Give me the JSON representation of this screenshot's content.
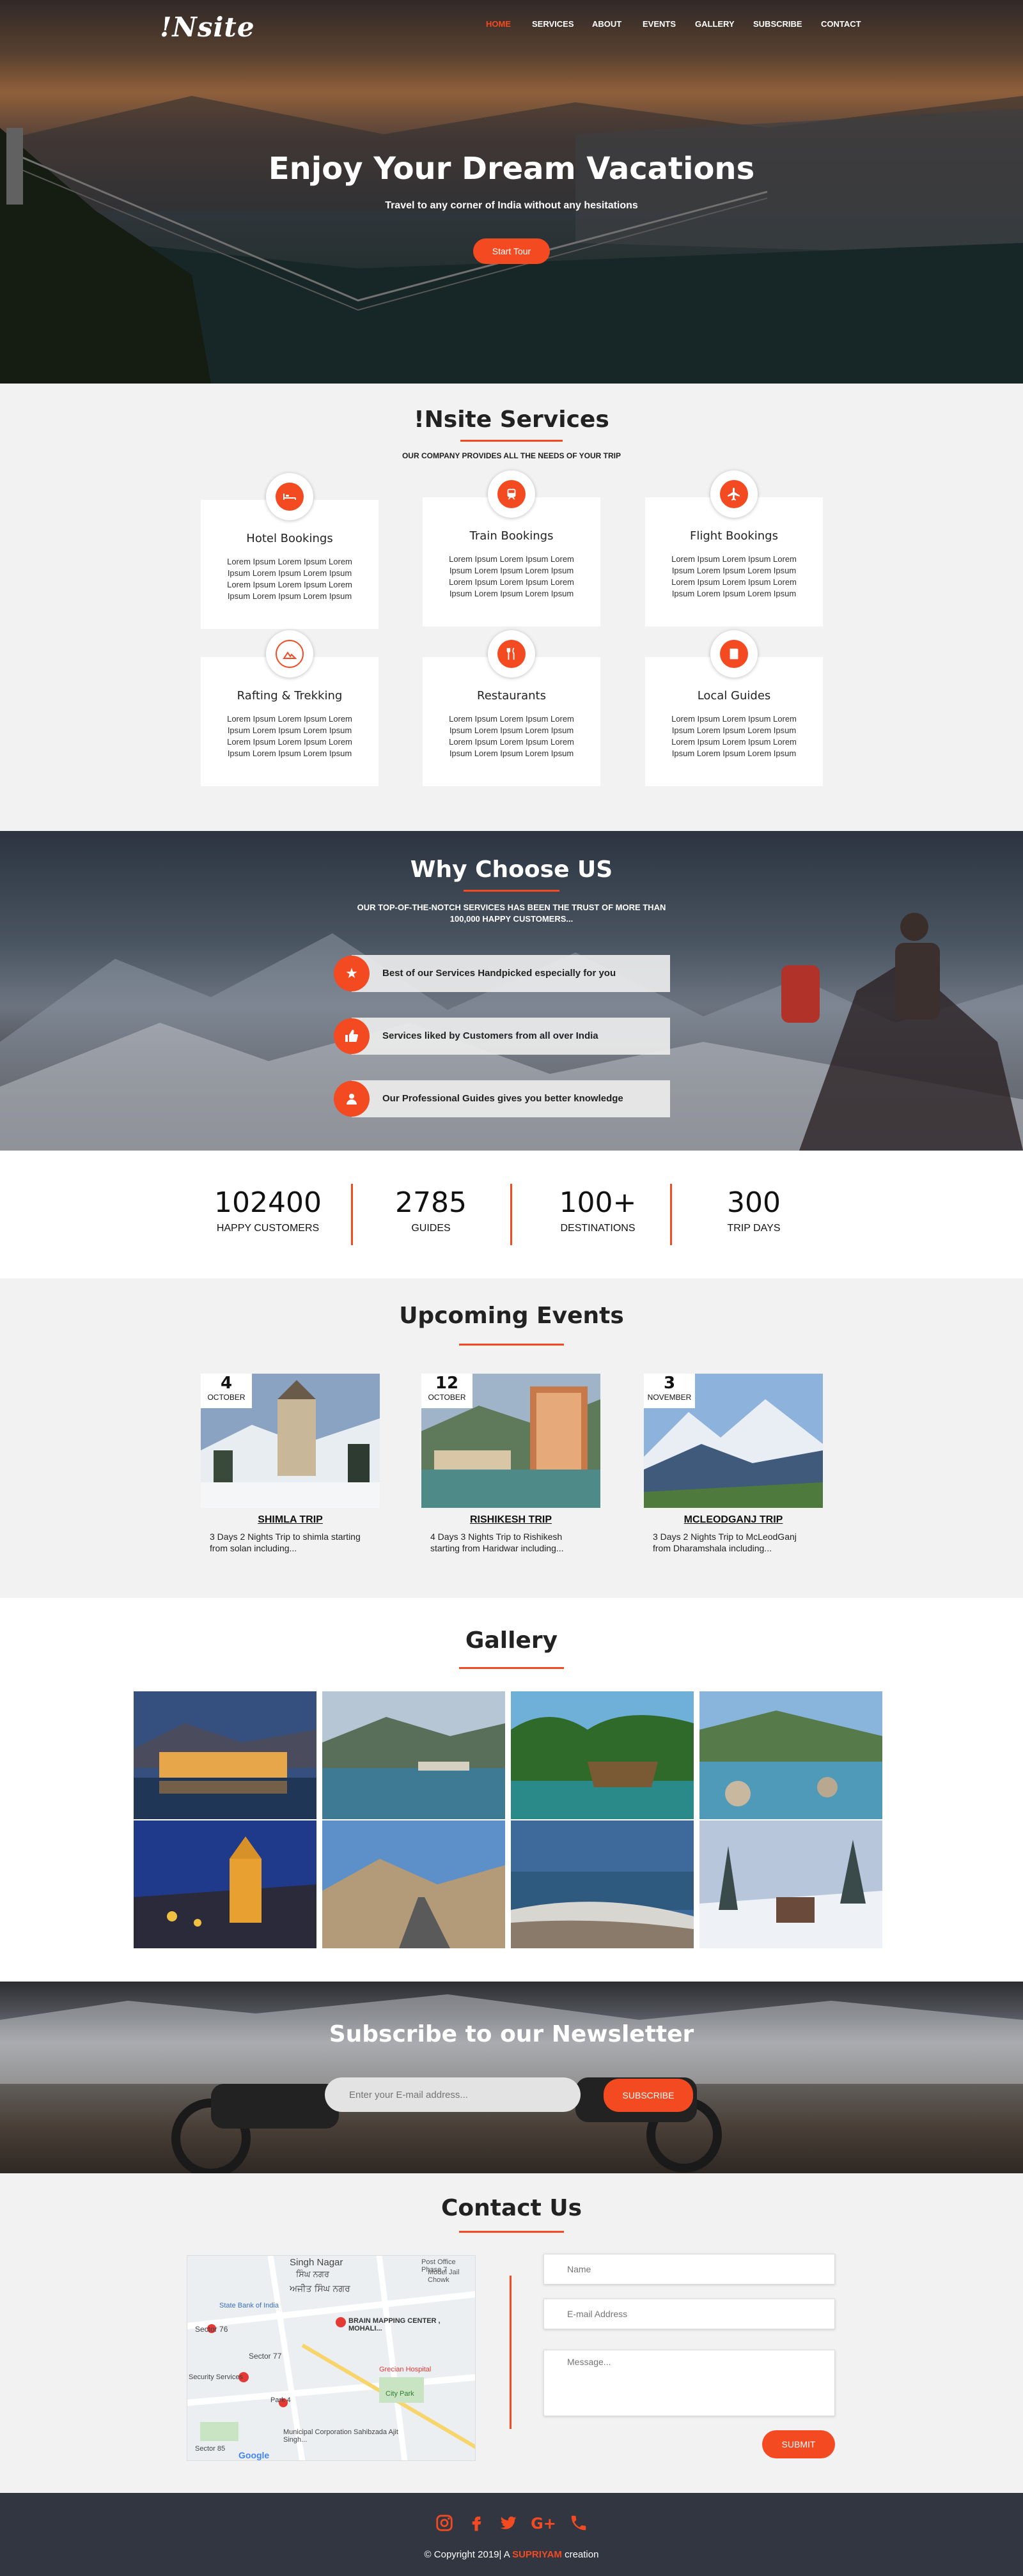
{
  "brand": "!Nsite",
  "nav": [
    "HOME",
    "SERVICES",
    "ABOUT",
    "EVENTS",
    "GALLERY",
    "SUBSCRIBE",
    "CONTACT"
  ],
  "hero": {
    "title": "Enjoy Your Dream Vacations",
    "subtitle": "Travel to any corner of India without any hesitations",
    "button": "Start Tour"
  },
  "services": {
    "title": "!Nsite Services",
    "subtitle": "OUR COMPANY PROVIDES ALL THE NEEDS OF YOUR TRIP",
    "items": [
      {
        "title": "Hotel Bookings",
        "icon": "bed-icon",
        "text": "Lorem Ipsum Lorem Ipsum Lorem Ipsum Lorem Ipsum Lorem Ipsum Lorem Ipsum Lorem Ipsum Lorem Ipsum Lorem Ipsum Lorem Ipsum"
      },
      {
        "title": "Train Bookings",
        "icon": "train-icon",
        "text": "Lorem Ipsum Lorem Ipsum Lorem Ipsum Lorem Ipsum Lorem Ipsum Lorem Ipsum Lorem Ipsum Lorem Ipsum Lorem Ipsum Lorem Ipsum"
      },
      {
        "title": "Flight Bookings",
        "icon": "plane-icon",
        "text": "Lorem Ipsum Lorem Ipsum Lorem Ipsum Lorem Ipsum Lorem Ipsum Lorem Ipsum Lorem Ipsum Lorem Ipsum Lorem Ipsum Lorem Ipsum"
      },
      {
        "title": "Rafting & Trekking",
        "icon": "mountain-icon",
        "text": "Lorem Ipsum Lorem Ipsum Lorem Ipsum Lorem Ipsum Lorem Ipsum Lorem Ipsum Lorem Ipsum Lorem Ipsum Lorem Ipsum Lorem Ipsum"
      },
      {
        "title": "Restaurants",
        "icon": "cutlery-icon",
        "text": "Lorem Ipsum Lorem Ipsum Lorem Ipsum Lorem Ipsum Lorem Ipsum Lorem Ipsum Lorem Ipsum Lorem Ipsum Lorem Ipsum Lorem Ipsum"
      },
      {
        "title": "Local Guides",
        "icon": "book-icon",
        "text": "Lorem Ipsum Lorem Ipsum Lorem Ipsum Lorem Ipsum Lorem Ipsum Lorem Ipsum Lorem Ipsum Lorem Ipsum Lorem Ipsum Lorem Ipsum"
      }
    ]
  },
  "why": {
    "title": "Why Choose US",
    "subtitle_line1": "OUR TOP-OF-THE-NOTCH SERVICES HAS BEEN THE TRUST OF MORE THAN",
    "subtitle_line2": "100,000 HAPPY CUSTOMERS...",
    "items": [
      {
        "text": "Best of our Services Handpicked especially for you",
        "icon": "star-icon"
      },
      {
        "text": "Services liked by Customers from all over India",
        "icon": "thumbs-up-icon"
      },
      {
        "text": "Our Professional Guides gives you better knowledge",
        "icon": "user-icon"
      }
    ]
  },
  "stats": [
    {
      "value": "102400",
      "label": "HAPPY CUSTOMERS"
    },
    {
      "value": "2785",
      "label": "GUIDES"
    },
    {
      "value": "100+",
      "label": "DESTINATIONS"
    },
    {
      "value": "300",
      "label": "TRIP DAYS"
    }
  ],
  "events": {
    "title": "Upcoming Events",
    "items": [
      {
        "day": "4",
        "month": "OCTOBER",
        "title": "SHIMLA TRIP",
        "desc": "3 Days 2 Nights Trip to shimla starting from solan including..."
      },
      {
        "day": "12",
        "month": "OCTOBER",
        "title": "RISHIKESH TRIP",
        "desc": "4 Days 3 Nights Trip to Rishikesh starting from Haridwar including..."
      },
      {
        "day": "3",
        "month": "NOVEMBER",
        "title": "MCLEODGANJ TRIP",
        "desc": "3 Days 2 Nights Trip to McLeodGanj from Dharamshala including..."
      }
    ]
  },
  "gallery": {
    "title": "Gallery"
  },
  "newsletter": {
    "title": "Subscribe to our Newsletter",
    "placeholder": "Enter your E-mail address...",
    "button": "SUBSCRIBE"
  },
  "contact": {
    "title": "Contact Us",
    "name_placeholder": "Name",
    "email_placeholder": "E-mail Address",
    "message_placeholder": "Message...",
    "submit": "SUBMIT",
    "map_labels": [
      "Singh Nagar",
      "ਸਿੰਘ ਨਗਰ",
      "ਅਜੀਤ ਸਿੰਘ ਨਗਰ",
      "Post Office Phase 7",
      "Model Jail Chowk",
      "State Bank of India",
      "BRAIN MAPPING CENTER , MOHALI...",
      "Sector 76",
      "Sector 77",
      "Grecian Hospital",
      "City Park",
      "Security Services",
      "Park 4",
      "Municipal Corporation Sahibzada Ajit Singh...",
      "Sector 85",
      "Google"
    ]
  },
  "footer": {
    "copy_prefix": "© Copyright 2019| A",
    "copy_brand": "SUPRIYAM",
    "copy_suffix": "creation"
  },
  "colors": {
    "accent": "#f34a22",
    "footer_bg": "#323641",
    "section_bg": "#f2f2f2"
  }
}
